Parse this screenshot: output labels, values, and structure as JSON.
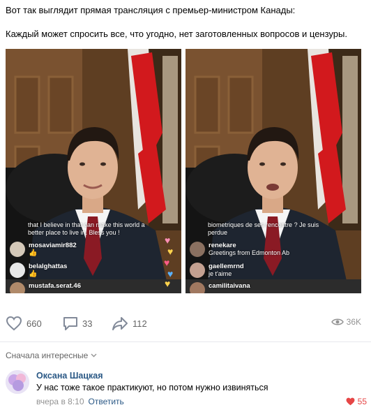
{
  "post": {
    "line1": "Вот так выглядит прямая трансляция с премьер-министром Канады:",
    "line2": "Каждый может спросить все, что угодно, нет заготовленных вопросов и цензуры."
  },
  "left_stream": {
    "caption_line1": "that I believe in that can make this world a",
    "caption_line2": "better place to live in. Bless you !",
    "comments": [
      {
        "name": "mosaviamir882",
        "message": "👍"
      },
      {
        "name": "belalghattas",
        "message": "👍"
      },
      {
        "name": "mustafa.serat.46",
        "message": ""
      }
    ]
  },
  "right_stream": {
    "caption_line1": "biometriques de ses rencontre ? Je suis",
    "caption_line2": "perdue",
    "comments": [
      {
        "name": "renekare",
        "message": "Greetings from Edmonton Ab"
      },
      {
        "name": "gaellemrnd",
        "message": "je t'aime"
      },
      {
        "name": "camilitaivana",
        "message": ""
      }
    ]
  },
  "actions": {
    "likes": "660",
    "comments": "33",
    "shares": "112",
    "views": "36K"
  },
  "sort": {
    "label": "Сначала интересные"
  },
  "comment": {
    "author": "Оксана Шацкая",
    "text": "У нас тоже такое практикуют, но потом нужно извиняться",
    "time": "вчера в 8:10",
    "reply_label": "Ответить",
    "likes": "55"
  },
  "colors": {
    "link": "#2a5885",
    "muted": "#939393",
    "like_red": "#e64646"
  }
}
